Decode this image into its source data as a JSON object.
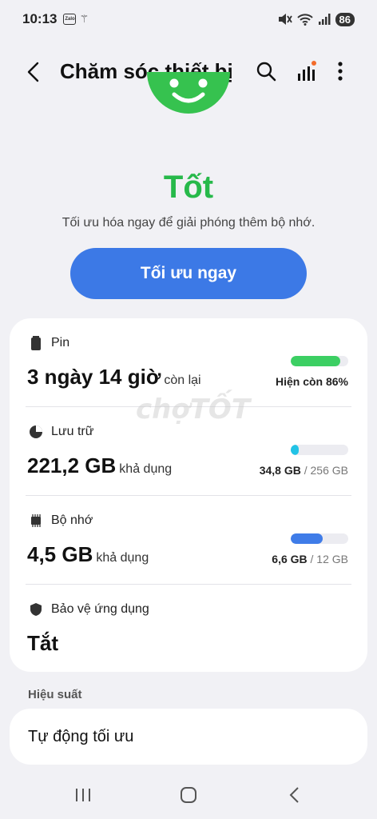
{
  "statusbar": {
    "time": "10:13",
    "zalo_label": "Zalo",
    "battery": "86",
    "icons": [
      "mute-icon",
      "wifi-icon",
      "signal-icon"
    ]
  },
  "appbar": {
    "title": "Chăm sóc thiết bị",
    "icons": [
      "back-icon",
      "search-icon",
      "stats-icon",
      "more-icon"
    ]
  },
  "status": {
    "word": "Tốt",
    "color": "#27b94a",
    "description": "Tối ưu hóa ngay để giải phóng thêm bộ nhớ.",
    "button": "Tối ưu ngay",
    "button_color": "#3c79e6"
  },
  "watermark": "chợTỐT",
  "rows": [
    {
      "label": "Pin",
      "icon": "battery-icon",
      "value": "3 ngày 14 giờ",
      "suffix": "còn lại",
      "right_strong": "Hiện còn 86%",
      "right_muted": "",
      "fill_percent": 86,
      "bar_color": "#3ccf63"
    },
    {
      "label": "Lưu trữ",
      "icon": "storage-pie-icon",
      "value": "221,2 GB",
      "suffix": "khả dụng",
      "right_strong": "34,8 GB",
      "right_muted": " / 256 GB",
      "fill_percent": 14,
      "bar_color": "#22c3e6"
    },
    {
      "label": "Bộ nhớ",
      "icon": "memory-chip-icon",
      "value": "4,5 GB",
      "suffix": "khả dụng",
      "right_strong": "6,6 GB",
      "right_muted": " / 12 GB",
      "fill_percent": 55,
      "bar_color": "#3f7ce8"
    },
    {
      "label": "Bảo vệ ứng dụng",
      "icon": "shield-icon",
      "value": "Tắt",
      "suffix": ""
    }
  ],
  "performance": {
    "section_title": "Hiệu suất",
    "item_label": "Tự động tối ưu"
  },
  "navbar": [
    "recents-icon",
    "home-icon",
    "back-nav-icon"
  ]
}
